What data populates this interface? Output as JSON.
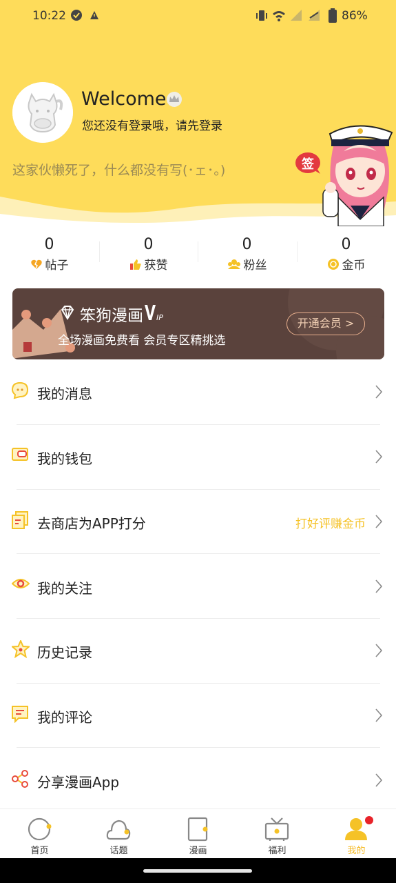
{
  "status_bar": {
    "time": "10:22",
    "battery": "86%"
  },
  "profile": {
    "welcome": "Welcome",
    "login_hint": "您还没有登录哦，请先登录",
    "bio": "这家伙懒死了，什么都没有写(･ェ･。)",
    "sign_label": "签"
  },
  "stats": [
    {
      "value": "0",
      "label": "帖子",
      "icon": "broken-heart-icon"
    },
    {
      "value": "0",
      "label": "获赞",
      "icon": "thumbs-up-icon"
    },
    {
      "value": "0",
      "label": "粉丝",
      "icon": "fans-icon"
    },
    {
      "value": "0",
      "label": "金币",
      "icon": "coin-icon"
    }
  ],
  "vip": {
    "title": "笨狗漫画",
    "subtitle": "全场漫画免费看 会员专区精挑选",
    "button": "开通会员 >"
  },
  "menu": [
    {
      "label": "我的消息",
      "icon": "message-icon"
    },
    {
      "label": "我的钱包",
      "icon": "wallet-icon"
    },
    {
      "label": "去商店为APP打分",
      "icon": "rate-icon",
      "extra": "打好评赚金币"
    },
    {
      "label": "我的关注",
      "icon": "eye-icon"
    },
    {
      "label": "历史记录",
      "icon": "star-icon"
    },
    {
      "label": "我的评论",
      "icon": "comment-icon"
    },
    {
      "label": "分享漫画App",
      "icon": "share-icon"
    }
  ],
  "tabs": [
    {
      "label": "首页",
      "icon": "home-icon"
    },
    {
      "label": "话题",
      "icon": "topic-icon"
    },
    {
      "label": "漫画",
      "icon": "comic-icon"
    },
    {
      "label": "福利",
      "icon": "tv-icon"
    },
    {
      "label": "我的",
      "icon": "profile-icon",
      "active": true
    }
  ],
  "colors": {
    "accent": "#fedc5a",
    "active_tab": "#f5b91f",
    "vip_bg": "#5a423c",
    "badge": "#e8232a"
  }
}
